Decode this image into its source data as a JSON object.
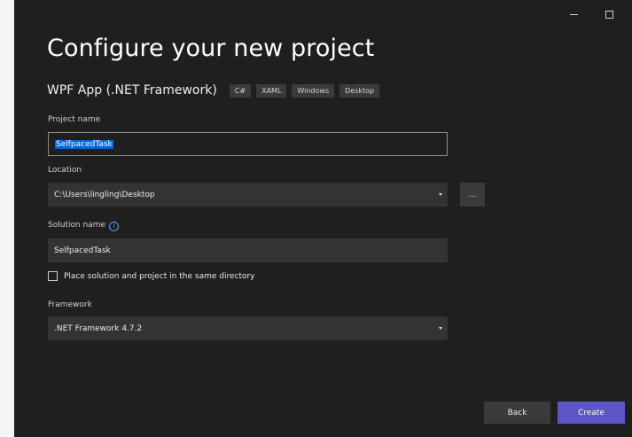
{
  "header": {
    "title": "Configure your new project",
    "template_name": "WPF App (.NET Framework)",
    "tags": [
      "C#",
      "XAML",
      "Windows",
      "Desktop"
    ]
  },
  "form": {
    "project_name": {
      "label": "Project name",
      "value": "SelfpacedTask"
    },
    "location": {
      "label": "Location",
      "value": "C:\\Users\\lingling\\Desktop",
      "browse_label": "..."
    },
    "solution_name": {
      "label": "Solution name",
      "value": "SelfpacedTask",
      "info_glyph": "i"
    },
    "same_directory": {
      "label": "Place solution and project in the same directory",
      "checked": false
    },
    "framework": {
      "label": "Framework",
      "value": ".NET Framework 4.7.2"
    }
  },
  "footer": {
    "back_label": "Back",
    "create_label": "Create"
  },
  "colors": {
    "background": "#1f1f1f",
    "input_bg": "#333333",
    "selection": "#0b61d6",
    "accent": "#5b55c8",
    "info": "#4da3ff"
  },
  "icons": {
    "minimize": "minimize-icon",
    "maximize": "maximize-icon",
    "dropdown": "chevron-down-icon",
    "info": "info-icon"
  }
}
